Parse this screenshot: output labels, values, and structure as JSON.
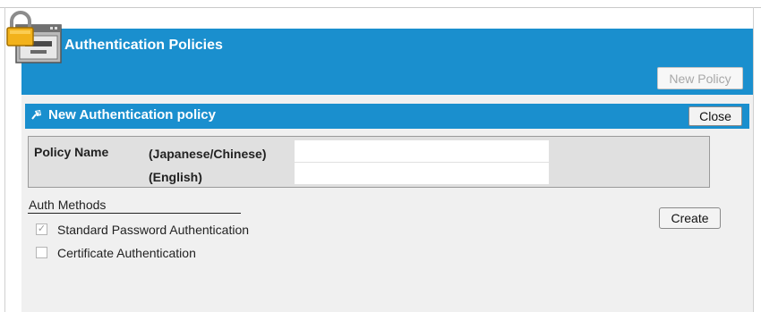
{
  "header": {
    "title": "Authentication Policies",
    "new_policy_label": "New Policy"
  },
  "form_panel": {
    "title": "New Authentication policy",
    "close_label": "Close",
    "policy_name_label": "Policy Name",
    "japanese_chinese_label": "(Japanese/Chinese)",
    "english_label": "(English)",
    "japanese_chinese_value": "",
    "english_value": ""
  },
  "auth_methods": {
    "heading": "Auth Methods",
    "options": [
      {
        "label": "Standard Password Authentication",
        "checked": true,
        "disabled": true
      },
      {
        "label": "Certificate Authentication",
        "checked": false,
        "disabled": false
      }
    ]
  },
  "create_label": "Create",
  "colors": {
    "header_blue": "#1a8fce",
    "panel_gray": "#f0f0f0",
    "form_gray": "#e0e0e0"
  },
  "icons": {
    "app_icon": "padlock-window-icon",
    "panel_icon": "pin-icon",
    "check_mark": "✓"
  }
}
